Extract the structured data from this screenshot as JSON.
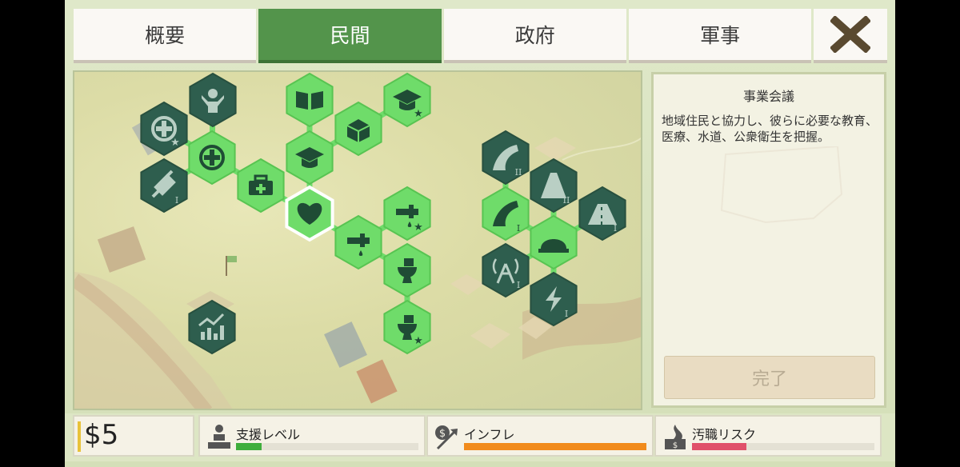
{
  "tabs": [
    {
      "label": "概要",
      "active": false
    },
    {
      "label": "民間",
      "active": true
    },
    {
      "label": "政府",
      "active": false
    },
    {
      "label": "軍事",
      "active": false
    }
  ],
  "close_icon": "close-x-icon",
  "panel": {
    "title": "事業会議",
    "description": "地域住民と協力し、彼らに必要な教育、医療、水道、公衆衛生を把握。",
    "complete_label": "完了"
  },
  "status": {
    "money": "$5",
    "support": {
      "label": "支援レベル",
      "level": 0.14,
      "color": "#3fae3c"
    },
    "inflation": {
      "label": "インフレ",
      "level": 1.0,
      "color": "#f18b1c"
    },
    "corruption": {
      "label": "汚職リスク",
      "level": 0.3,
      "color": "#e0506a"
    }
  },
  "tree": {
    "nodes": [
      {
        "id": "medical",
        "icon": "medical-cross-icon",
        "state": "unlocked",
        "tier": ""
      },
      {
        "id": "medical-plus",
        "icon": "medical-cross-star-icon",
        "state": "locked",
        "tier": ""
      },
      {
        "id": "child-care",
        "icon": "child-care-icon",
        "state": "locked",
        "tier": ""
      },
      {
        "id": "vaccine",
        "icon": "syringe-icon",
        "state": "locked",
        "tier": "I"
      },
      {
        "id": "first-aid",
        "icon": "first-aid-kit-icon",
        "state": "unlocked",
        "tier": ""
      },
      {
        "id": "heart",
        "icon": "heart-icon",
        "state": "selected",
        "tier": ""
      },
      {
        "id": "education",
        "icon": "graduation-cap-icon",
        "state": "unlocked",
        "tier": ""
      },
      {
        "id": "library",
        "icon": "open-book-icon",
        "state": "unlocked",
        "tier": ""
      },
      {
        "id": "supplies",
        "icon": "box-icon",
        "state": "unlocked",
        "tier": ""
      },
      {
        "id": "education-plus",
        "icon": "graduation-cap-star-icon",
        "state": "unlocked",
        "tier": ""
      },
      {
        "id": "water",
        "icon": "water-tap-icon",
        "state": "unlocked",
        "tier": ""
      },
      {
        "id": "water-plus",
        "icon": "water-tap-star-icon",
        "state": "unlocked",
        "tier": ""
      },
      {
        "id": "sanitation",
        "icon": "toilet-icon",
        "state": "unlocked",
        "tier": ""
      },
      {
        "id": "sanitation-plus",
        "icon": "toilet-star-icon",
        "state": "unlocked",
        "tier": ""
      },
      {
        "id": "economy",
        "icon": "growth-chart-icon",
        "state": "locked",
        "tier": ""
      },
      {
        "id": "road-curve-2",
        "icon": "curved-road-icon",
        "state": "locked",
        "tier": "II"
      },
      {
        "id": "road-curve-1",
        "icon": "curved-road-icon",
        "state": "unlocked",
        "tier": "I"
      },
      {
        "id": "road-2",
        "icon": "road-icon",
        "state": "locked",
        "tier": "II"
      },
      {
        "id": "construction",
        "icon": "hard-hat-icon",
        "state": "unlocked",
        "tier": ""
      },
      {
        "id": "highway",
        "icon": "highway-icon",
        "state": "locked",
        "tier": "I"
      },
      {
        "id": "telecom",
        "icon": "radio-tower-icon",
        "state": "locked",
        "tier": "I"
      },
      {
        "id": "power",
        "icon": "lightning-icon",
        "state": "locked",
        "tier": "I"
      }
    ]
  }
}
